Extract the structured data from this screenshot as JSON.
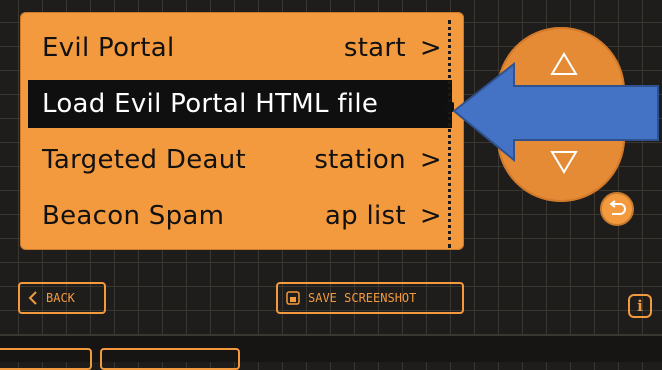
{
  "menu": {
    "items": [
      {
        "label": "Evil Portal",
        "value": "start",
        "arrow": ">"
      },
      {
        "label": "Load Evil Portal HTML file",
        "value": "",
        "arrow": ""
      },
      {
        "label": "Targeted Deaut",
        "value": "station",
        "arrow": ">"
      },
      {
        "label": "Beacon Spam",
        "value": "ap list",
        "arrow": ">"
      }
    ],
    "selected_index": 1
  },
  "footer": {
    "back_label": "BACK",
    "save_label": "SAVE SCREENSHOT",
    "info_label": "i"
  },
  "colors": {
    "accent": "#f49a3e",
    "arrow": "#4472c4",
    "background": "#1e1d1b",
    "selected_bg": "#0f0f0f"
  },
  "icons": [
    "up-triangle-icon",
    "down-triangle-icon",
    "return-icon",
    "back-chevron-icon",
    "save-icon",
    "info-icon"
  ]
}
